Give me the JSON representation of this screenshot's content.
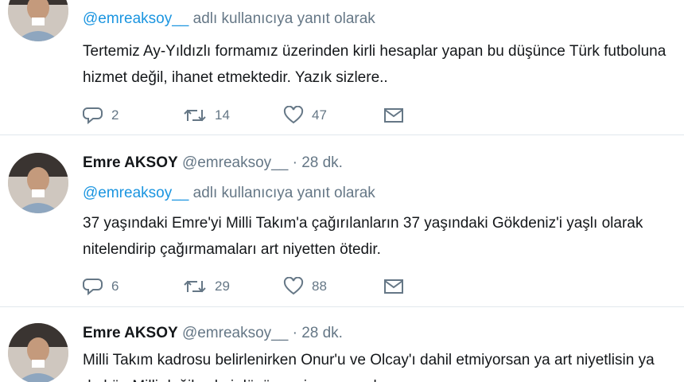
{
  "colors": {
    "text": "#14171a",
    "muted": "#657786",
    "link": "#1b95e0",
    "divider": "#e1e8ed"
  },
  "icons": {
    "reply": "reply-icon",
    "retweet": "retweet-icon",
    "like": "heart-icon",
    "dm": "envelope-icon"
  },
  "tweets": [
    {
      "reply_handle": "@emreaksoy__",
      "reply_suffix": " adlı kullanıcıya yanıt olarak",
      "text": "Tertemiz Ay-Yıldızlı formamız üzerinden kirli hesaplar yapan bu düşünce Türk futboluna hizmet değil, ihanet etmektedir. Yazık sizlere..",
      "replies": "2",
      "retweets": "14",
      "likes": "47"
    },
    {
      "name": "Emre AKSOY",
      "handle": "@emreaksoy__",
      "dot": "·",
      "time": "28 dk.",
      "reply_handle": "@emreaksoy__",
      "reply_suffix": " adlı kullanıcıya yanıt olarak",
      "text": "37 yaşındaki Emre'yi Milli Takım'a çağırılanların 37 yaşındaki Gökdeniz'i yaşlı olarak nitelendirip çağırmamaları art niyetten ötedir.",
      "replies": "6",
      "retweets": "29",
      "likes": "88"
    },
    {
      "name": "Emre AKSOY",
      "handle": "@emreaksoy__",
      "dot": "·",
      "time": "28 dk.",
      "text": "Milli Takım kadrosu belirlenirken Onur'u ve Olcay'ı dahil etmiyorsan ya art niyetlisin ya da kör. Milli değil şahsi düşüncenin sonucudur."
    }
  ]
}
